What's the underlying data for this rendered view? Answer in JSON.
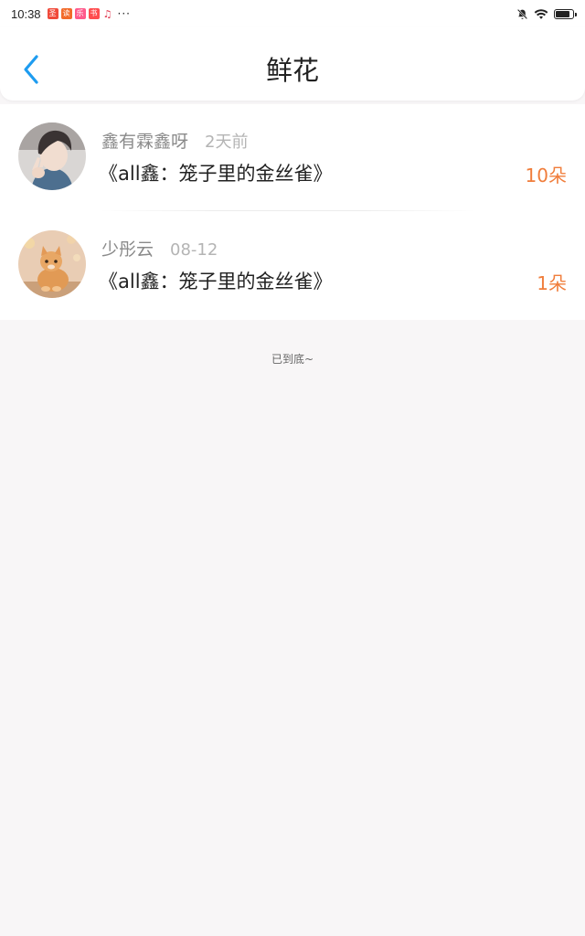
{
  "status_bar": {
    "time": "10:38",
    "more": "···",
    "app_icons": [
      {
        "name": "app-icon-red",
        "color": "#f04a3a",
        "glyph": "圣"
      },
      {
        "name": "app-icon-orange",
        "color": "#f26b2a",
        "glyph": "读"
      },
      {
        "name": "app-icon-pink",
        "color": "#ff5a8c",
        "glyph": "乐"
      },
      {
        "name": "app-icon-red-2",
        "color": "#ff4d4f",
        "glyph": "书"
      },
      {
        "name": "app-icon-music",
        "color": "#ffffff",
        "glyph": "♫"
      }
    ],
    "right_icons": [
      "bell-off-icon",
      "wifi-icon",
      "battery-icon"
    ],
    "battery_level": 0.85
  },
  "header": {
    "back_icon": "chevron-left-icon",
    "title": "鲜花",
    "accent_color": "#1e9cf0"
  },
  "gifts": [
    {
      "user": "鑫有霖鑫呀",
      "time": "2天前",
      "book": "《all鑫：笼子里的金丝雀》",
      "count": "10朵",
      "avatar": "avatar-person"
    },
    {
      "user": "少彤云",
      "time": "08-12",
      "book": "《all鑫：笼子里的金丝雀》",
      "count": "1朵",
      "avatar": "avatar-cat"
    }
  ],
  "footer": {
    "end_text": "已到底~"
  }
}
